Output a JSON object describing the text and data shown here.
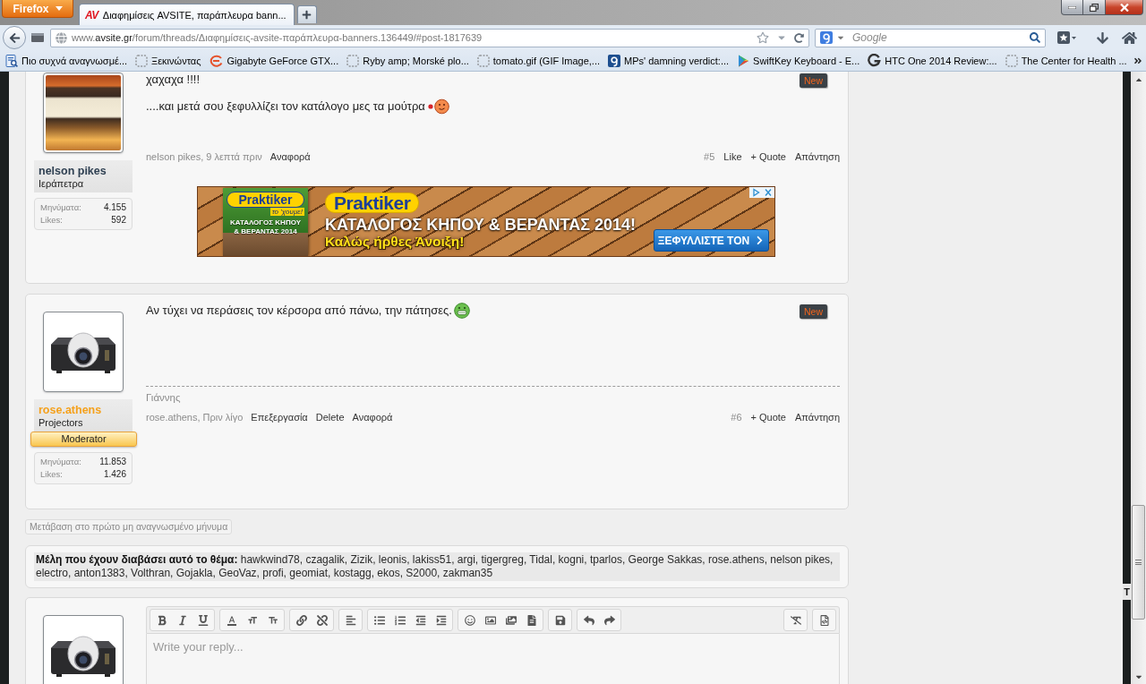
{
  "browser": {
    "menu_button": "Firefox",
    "tabs": [
      {
        "favicon": "AV",
        "title": "Διαφημίσεις AVSITE, παράπλευρα bann...",
        "selected": true
      }
    ],
    "url": {
      "prefix": "www.",
      "domain": "avsite.gr",
      "path": "/forum/threads/Διαφημίσεις-avsite-παράπλευρα-banners.136449/#post-1817639"
    },
    "search": {
      "placeholder": "Google"
    },
    "bookmarks": [
      {
        "kind": "folder",
        "label": "Πιο συχνά αναγνωσμέ..."
      },
      {
        "kind": "blank",
        "label": "Ξεκινώντας"
      },
      {
        "kind": "swirl",
        "label": "Gigabyte GeForce GTX..."
      },
      {
        "kind": "blank",
        "label": "Ryby amp; Morské plo..."
      },
      {
        "kind": "blank",
        "label": "tomato.gif (GIF Image,..."
      },
      {
        "kind": "tile",
        "label": "MPs' damning verdict:..."
      },
      {
        "kind": "triangle",
        "label": "SwiftKey Keyboard - E..."
      },
      {
        "kind": "ring",
        "label": "HTC One 2014 Review:..."
      },
      {
        "kind": "blank",
        "label": "The Center for Health ..."
      }
    ]
  },
  "thread": {
    "posts": [
      {
        "user": {
          "name": "nelson pikes",
          "color": "#2f4052",
          "title": "Ιεράπετρα",
          "avatar": {
            "kind": "photo"
          },
          "stats": [
            {
              "label": "Μηνύματα:",
              "value": "4.155"
            },
            {
              "label": "Likes:",
              "value": "592"
            }
          ]
        },
        "new_badge": "New",
        "paragraphs": [
          {
            "text": "χαχαχα !!!!"
          },
          {
            "text": "....και μετά σου ξεφυλλίζει τον κατάλογο μες τα μούτρα",
            "smiley": {
              "kind": "kiss"
            }
          }
        ],
        "byline": "nelson pikes, 9 λεπτά πριν",
        "links": [
          "Αναφορά"
        ],
        "number": "#5",
        "actions": [
          "Like",
          "+ Quote",
          "Απάντηση"
        ],
        "ad": {
          "cover": {
            "logo": "Praktiker",
            "slogan": "το 'χουμε!",
            "title": "ΚΑΤΑΛΟΓΟΣ ΚΗΠΟΥ & ΒΕΡΑΝΤΑΣ 2014"
          },
          "logo": "Praktiker",
          "headline": "ΚΑΤΑΛΟΓΟΣ ΚΗΠΟΥ & ΒΕΡΑΝΤΑΣ 2014!",
          "subline": "Καλώς ήρθες Άνοιξη!",
          "button": "ΞΕΦΥΛΛΙΣΤΕ ΤΟΝ"
        }
      },
      {
        "user": {
          "name": "rose.athens",
          "color": "#f5a11c",
          "title": "Projectors",
          "badge": "Moderator",
          "avatar": {
            "kind": "projector"
          },
          "stats": [
            {
              "label": "Μηνύματα:",
              "value": "11.853"
            },
            {
              "label": "Likes:",
              "value": "1.426"
            }
          ]
        },
        "new_badge": "New",
        "paragraphs": [
          {
            "text": "Αν τύχει να περάσεις τον κέρσορα από πάνω, την πάτησες.",
            "smiley": {
              "kind": "grin"
            }
          }
        ],
        "signature": "Γιάννης",
        "byline": "rose.athens, Πριν λίγο",
        "links": [
          "Επεξεργασία",
          "Delete",
          "Αναφορά"
        ],
        "number": "#6",
        "actions": [
          "+ Quote",
          "Απάντηση"
        ]
      }
    ],
    "unread_link": "Μετάβαση στο πρώτο μη αναγνωσμένο μήνυμα",
    "readers": {
      "text": "**Μέλη που έχουν διαβάσει αυτό το θέμα:** hawkwind78, czagalik, Zizik, leonis, lakiss51, argi, tigergreg, Tidal, kogni, tparlos, George Sakkas, rose.athens, nelson pikes, electro, anton1383, Volthran, Gojakla, GeoVaz, profi, geomiat, kostagg, ekos, S2000, zakman35"
    },
    "reply": {
      "avatar": {
        "kind": "projector"
      },
      "placeholder": "Write your reply..."
    }
  },
  "side_tab": "T"
}
